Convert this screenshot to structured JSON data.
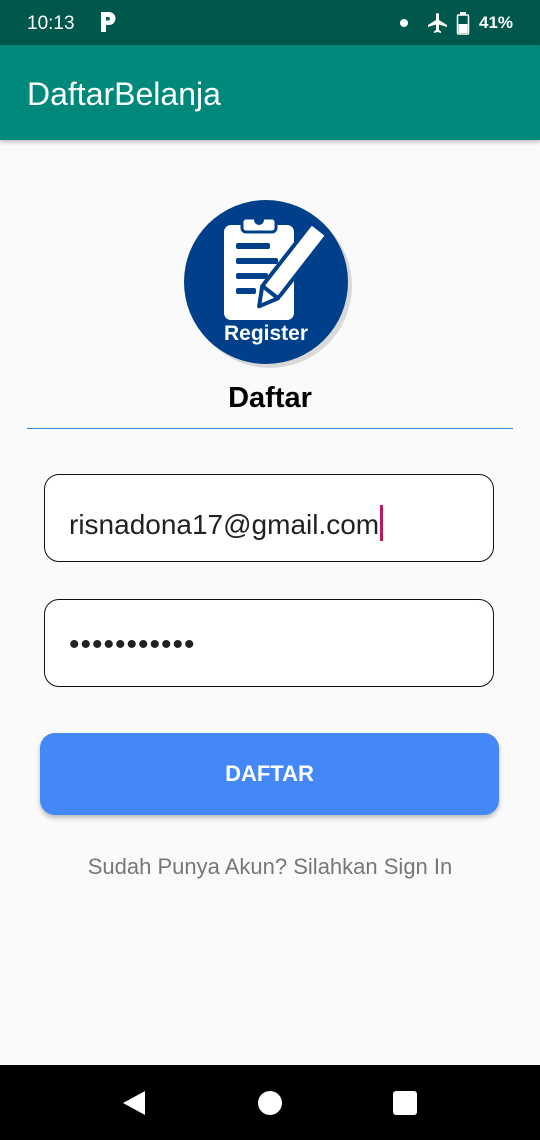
{
  "status_bar": {
    "time": "10:13",
    "battery": "41%",
    "icons": [
      "parking-app-icon",
      "notification-dot",
      "airplane-mode-icon",
      "battery-icon"
    ]
  },
  "app_bar": {
    "title": "DaftarBelanja",
    "color": "#00897b"
  },
  "logo": {
    "label": "Register",
    "icon": "clipboard-pencil-icon",
    "color": "#003f8a"
  },
  "form": {
    "heading": "Daftar",
    "email_value": "risnadona17@gmail.com",
    "password_value": "•••••••••••",
    "submit_label": "DAFTAR",
    "submit_color": "#4488f8",
    "signin_link": "Sudah Punya Akun? Silahkan Sign In"
  },
  "nav_bar": {
    "icons": [
      "back-icon",
      "home-icon",
      "recents-icon"
    ]
  }
}
